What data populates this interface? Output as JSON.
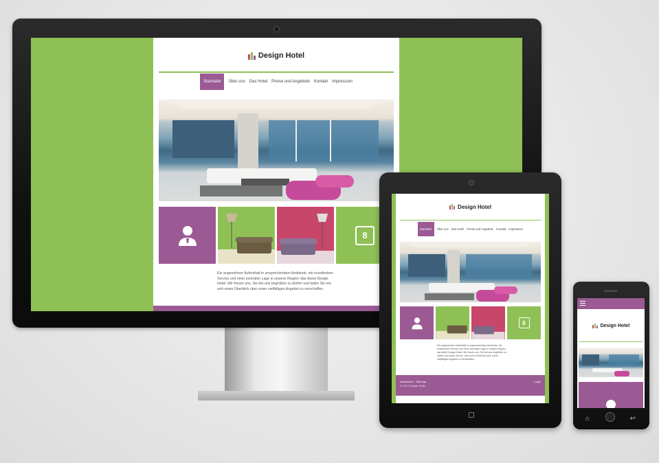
{
  "colors": {
    "purple": "#9b5a94",
    "green": "#8fc055",
    "pink": "#c9466b",
    "white": "#ffffff"
  },
  "site": {
    "brand": "Design Hotel",
    "nav": [
      "Startseite",
      "Über uns",
      "Das Hotel",
      "Preise und Angebote",
      "Kontakt",
      "Impressum"
    ],
    "active_nav": "Startseite",
    "intro": "Ein angenehmer Aufenthalt in ansprechendem Ambiente, mit exzellentem Service und einer zentralen Lage in unserer Region: das bietet Design Hotel. Wir freuen uns, Sie bei uns begrüßen zu dürfen und laden Sie ein, sich einen Überblick über unser vielfältiges Angebot zu verschaffen.",
    "intro_tablet": "Ein angenehmer Aufenthalt in ansprechendem Ambiente, mit exzellentem Service und einer zentralen Lage in unserer Region: das bietet Design Hotel. Wir freuen uns, Sie bei uns begrüßen zu dürfen und laden Sie ein, sich einen Überblick über unser vielfältiges Angebot zu verschaffen.",
    "footer_links": "Impressum · Sitemap",
    "footer_copy": "© 2014 Design Hotel",
    "footer_login": "Login",
    "calendar_day": "8"
  },
  "icons": [
    "person-icon",
    "calendar-icon",
    "menu-icon",
    "home-icon",
    "back-icon",
    "camera-icon"
  ]
}
